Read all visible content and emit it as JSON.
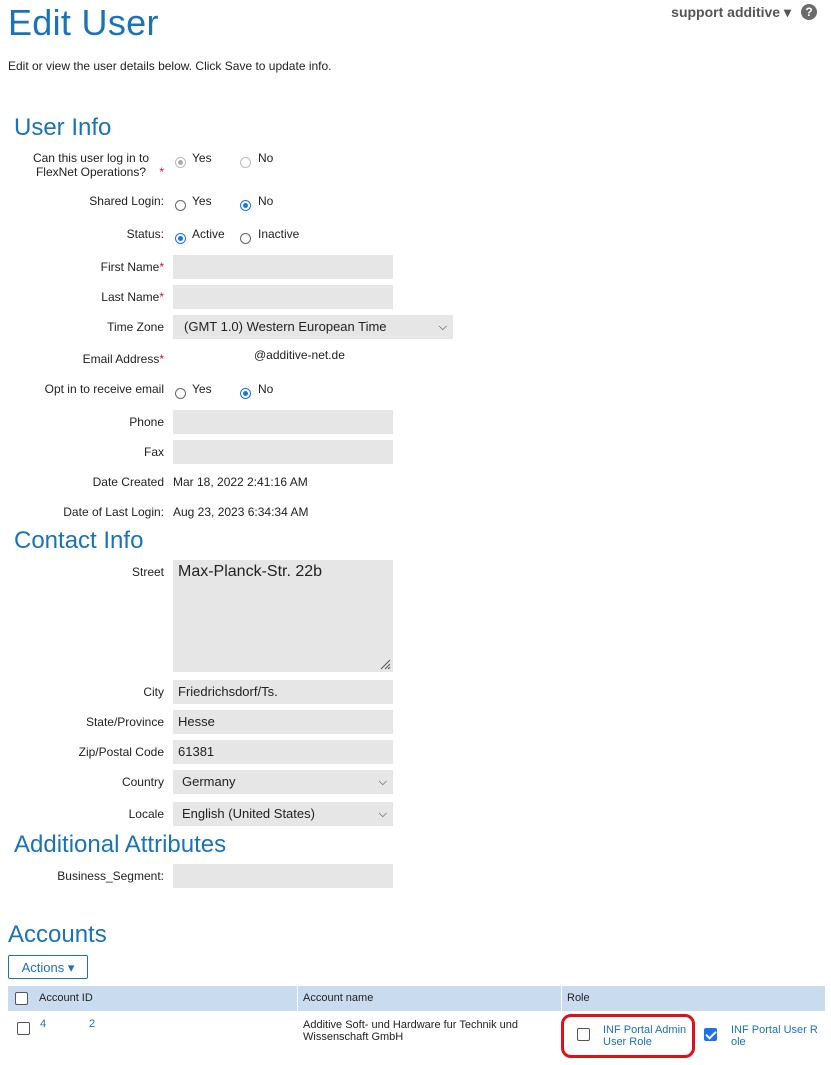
{
  "header": {
    "title": "Edit User",
    "user_menu": "support additive ▾",
    "help": "?",
    "intro": "Edit or view the user details below. Click Save to update info."
  },
  "user_info": {
    "heading": "User Info",
    "can_login_label": "Can this user log in to FlexNet Operations?",
    "can_login_yes": "Yes",
    "can_login_no": "No",
    "shared_login_label": "Shared Login:",
    "shared_yes": "Yes",
    "shared_no": "No",
    "status_label": "Status:",
    "status_active": "Active",
    "status_inactive": "Inactive",
    "first_name_label": "First Name",
    "first_name_value": "",
    "last_name_label": "Last Name",
    "last_name_value": "",
    "timezone_label": "Time Zone",
    "timezone_value": "(GMT 1.0) Western European Time",
    "email_label": "Email Address",
    "email_value": "@additive-net.de",
    "optin_label": "Opt in to receive email",
    "optin_yes": "Yes",
    "optin_no": "No",
    "phone_label": "Phone",
    "phone_value": "",
    "fax_label": "Fax",
    "fax_value": "",
    "date_created_label": "Date Created",
    "date_created_value": "Mar 18, 2022 2:41:16 AM",
    "last_login_label": "Date of Last Login:",
    "last_login_value": "Aug 23, 2023 6:34:34 AM",
    "required_mark": "*"
  },
  "contact_info": {
    "heading": "Contact Info",
    "street_label": "Street",
    "street_value": "Max-Planck-Str. 22b",
    "city_label": "City",
    "city_value": "Friedrichsdorf/Ts.",
    "state_label": "State/Province",
    "state_value": "Hesse",
    "zip_label": "Zip/Postal Code",
    "zip_value": "61381",
    "country_label": "Country",
    "country_value": "Germany",
    "locale_label": "Locale",
    "locale_value": "English (United States)"
  },
  "additional": {
    "heading": "Additional Attributes",
    "business_label": "Business_Segment:",
    "business_value": ""
  },
  "accounts": {
    "heading": "Accounts",
    "actions_label": "Actions ▾",
    "columns": [
      "Account ID",
      "Account name",
      "Role"
    ],
    "row": {
      "id_part1": "4",
      "id_part2": "2",
      "name_line1": "Additive Soft- und Hardware fur Technik und",
      "name_line2": "Wissenschaft GmbH",
      "role1_line1": "INF Portal Admin",
      "role1_line2": "User Role",
      "role2_line1": "INF Portal User R",
      "role2_line2": "ole"
    }
  },
  "colors": {
    "accent": "#1a73b8",
    "header_row": "#c9dcef",
    "field_bg": "#e6e6e6",
    "highlight": "#e0101a"
  }
}
